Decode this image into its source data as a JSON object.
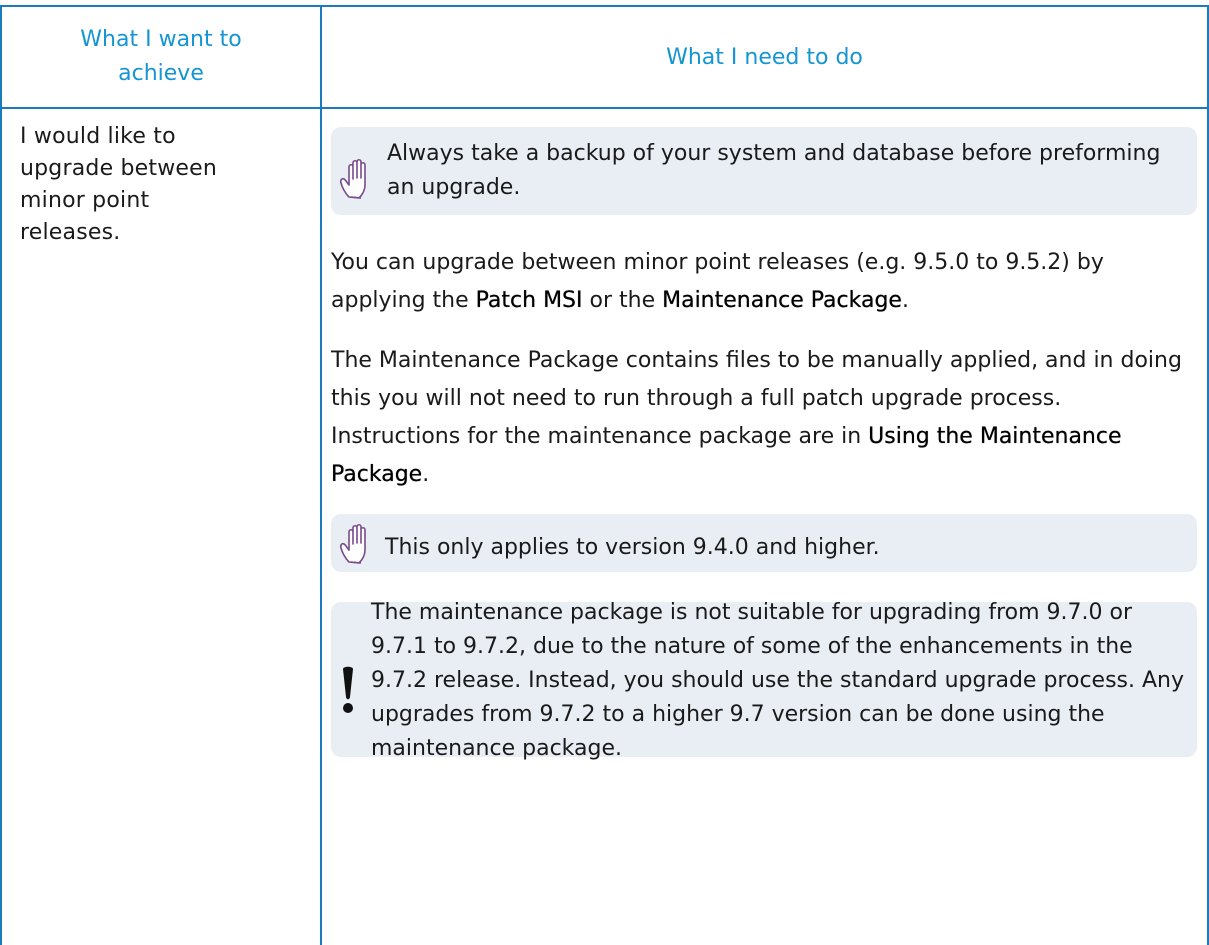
{
  "table": {
    "header": {
      "col1": "What I want to achieve",
      "col2": "What I need to do"
    },
    "row": {
      "left_text": "I would like to upgrade between minor point releases.",
      "note_backup": "Always take a backup of your system and database before preforming an upgrade.",
      "para1": {
        "before": "You can upgrade between minor point releases (e.g. 9.5.0 to 9.5.2) by applying the ",
        "patch_msi": "Patch MSI",
        "middle": " or the ",
        "maintenance_package": "Maintenance Package",
        "end": "."
      },
      "para2": {
        "text": "The Maintenance Package contains files to be manually applied, and in doing this you will not need to run through a full patch upgrade process. Instructions for the maintenance package are in ",
        "link": "Using the Maintenance Package",
        "end": "."
      },
      "note_version": "This only applies to version 9.4.0 and higher.",
      "warning": "The maintenance package is not suitable for upgrading from 9.7.0 or 9.7.1 to 9.7.2, due to the nature of some of the enhancements in the 9.7.2 release. Instead, you should use the standard upgrade process. Any upgrades from 9.7.2 to a higher 9.7 version can be done using the maintenance package."
    }
  },
  "icons": {
    "note": "raised-hand-icon",
    "warning": "exclamation-icon"
  },
  "colors": {
    "border": "#1a7bbf",
    "header_text": "#1596d3",
    "note_background": "#e8eef3"
  }
}
